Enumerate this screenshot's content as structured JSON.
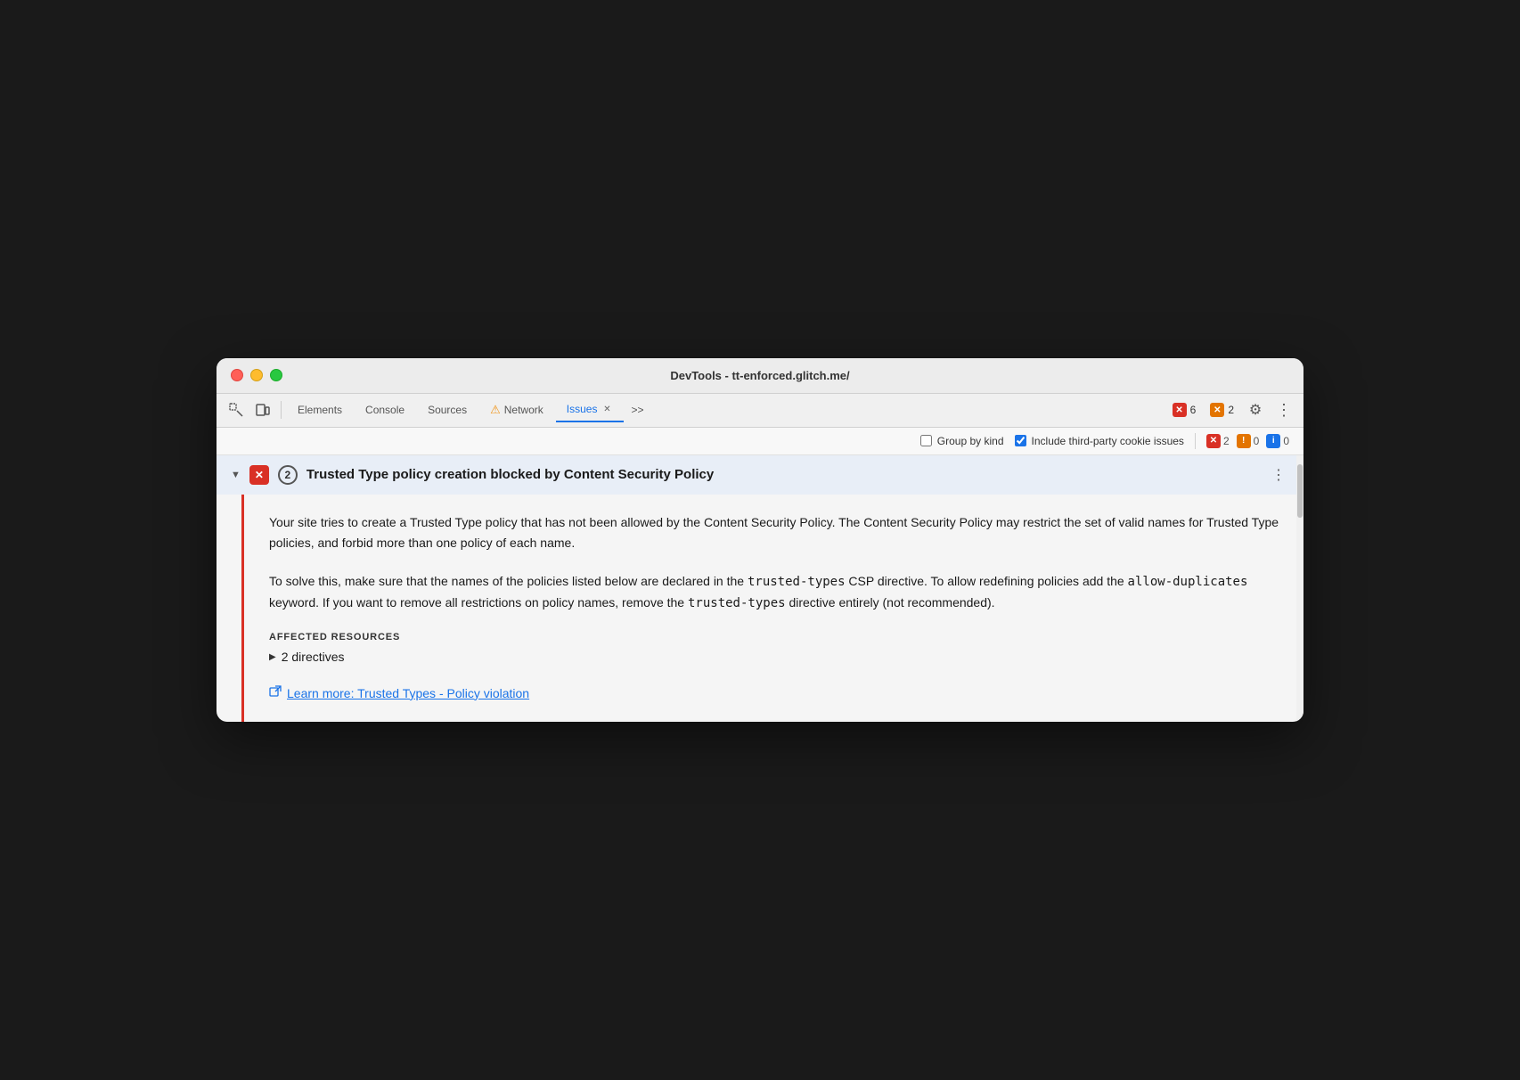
{
  "window": {
    "title": "DevTools - tt-enforced.glitch.me/"
  },
  "toolbar": {
    "elements_label": "Elements",
    "console_label": "Console",
    "sources_label": "Sources",
    "network_label": "Network",
    "issues_label": "Issues",
    "more_tabs_label": ">>",
    "error_count": "6",
    "warning_count": "2",
    "network_warning": "⚠",
    "settings_icon": "⚙",
    "more_icon": "⋮"
  },
  "subbar": {
    "group_by_kind_label": "Group by kind",
    "include_third_party_label": "Include third-party cookie issues",
    "error_count": "2",
    "warning_count": "0",
    "info_count": "0"
  },
  "issue": {
    "title": "Trusted Type policy creation blocked by Content Security Policy",
    "count": "2",
    "description_1": "Your site tries to create a Trusted Type policy that has not been allowed by the Content Security Policy. The Content Security Policy may restrict the set of valid names for Trusted Type policies, and forbid more than one policy of each name.",
    "description_2_pre": "To solve this, make sure that the names of the policies listed below are declared in the ",
    "code_1": "trusted-types",
    "description_2_mid1": " CSP directive. To allow redefining policies add the ",
    "code_2": "allow-duplicates",
    "description_2_mid2": " keyword. If you want to remove all restrictions on policy names, remove the ",
    "code_3": "trusted-types",
    "description_2_post": " directive entirely (not recommended).",
    "affected_resources_label": "AFFECTED RESOURCES",
    "directives_label": "2 directives",
    "learn_more_text": "Learn more: Trusted Types - Policy violation"
  }
}
